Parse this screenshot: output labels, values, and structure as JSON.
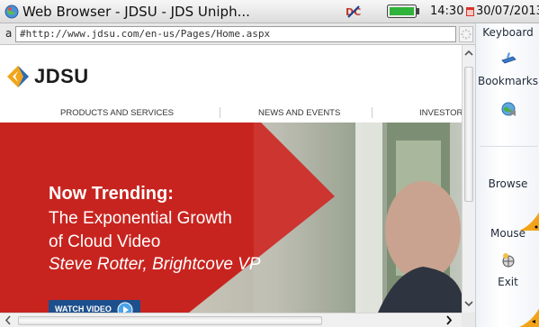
{
  "window": {
    "title": "Web Browser - JDSU - JDS Uniph...",
    "clock": "14:30",
    "date": "30/07/2013"
  },
  "address_bar": {
    "prefix": "a",
    "url": "#http://www.jdsu.com/en-us/Pages/Home.aspx"
  },
  "page": {
    "logo_text": "JDSU",
    "nav": [
      "PRODUCTS AND SERVICES",
      "NEWS AND EVENTS",
      "INVESTOR"
    ],
    "hero": {
      "heading": "Now Trending:",
      "line1": "The Exponential Growth",
      "line2": "of Cloud Video",
      "byline": "Steve Rotter, Brightcove VP",
      "button": "WATCH VIDEO"
    }
  },
  "side_panel": {
    "keyboard": "Keyboard",
    "bookmarks": "Bookmarks",
    "browse": "Browse",
    "mouse": "Mouse",
    "exit": "Exit"
  },
  "icons": {
    "title": "globe-icon",
    "dc": "dc-power-icon",
    "battery": "battery-icon",
    "calendar": "calendar-icon",
    "bookmarks": "bookmark-globe-icon",
    "keyboard": "keyboard-icon",
    "mouse": "mouse-icon"
  },
  "colors": {
    "hero_red": "#c8241f",
    "button_blue": "#1d4f8c",
    "battery_green": "#2fb33a",
    "fold_orange": "#f3a319"
  }
}
